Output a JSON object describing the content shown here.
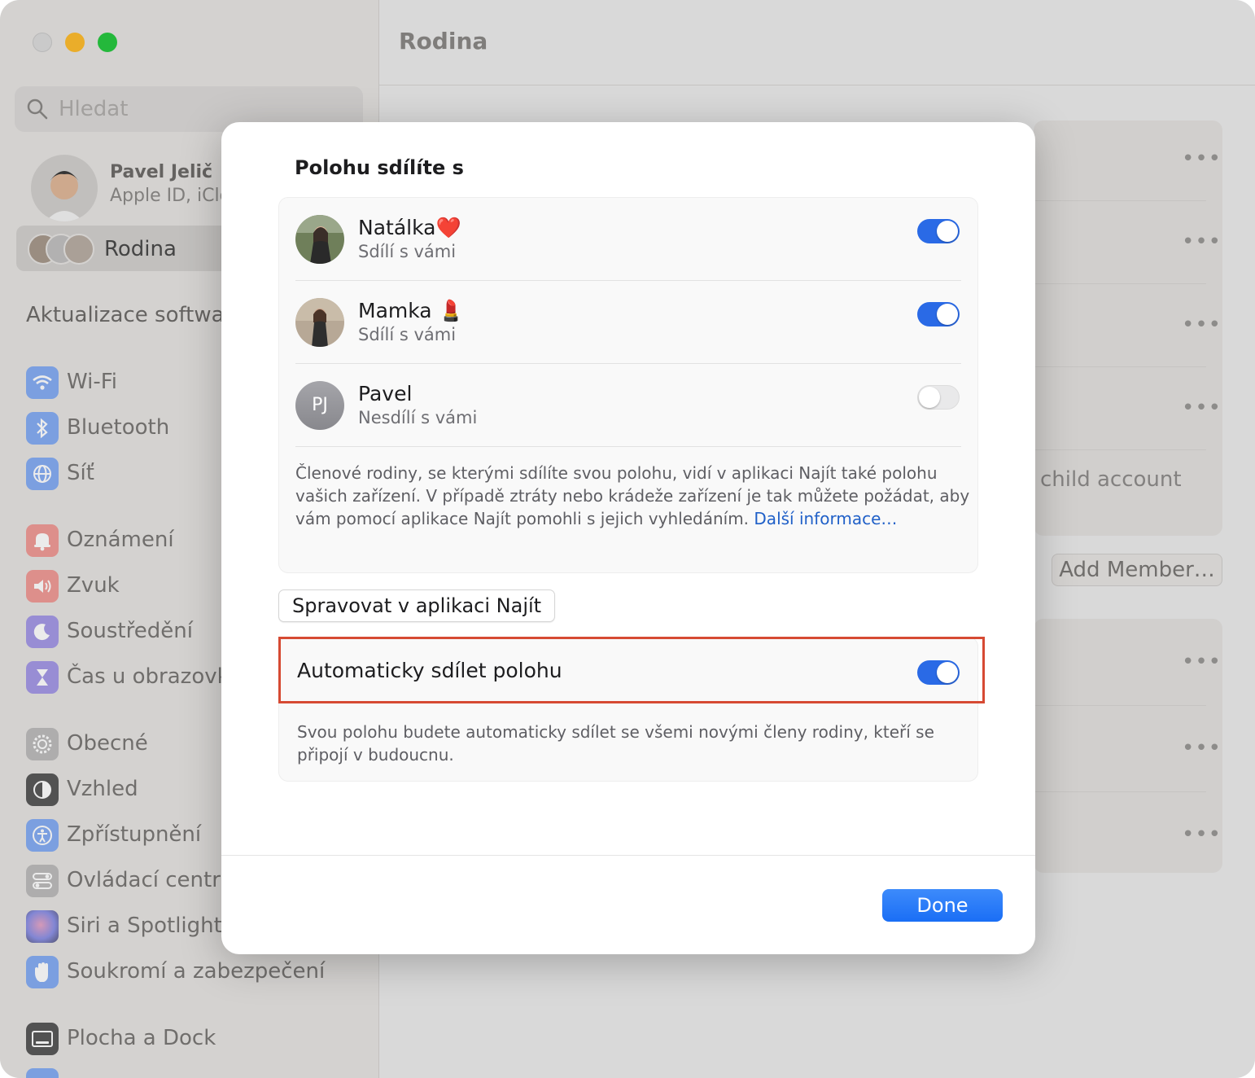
{
  "sidebar": {
    "search_placeholder": "Hledat",
    "profile": {
      "name": "Pavel Jelič",
      "subtitle": "Apple ID, iClo"
    },
    "selected_item": "Rodina",
    "update_label": "Aktualizace softwaru",
    "items": [
      {
        "label": "Wi‑Fi",
        "icon": "wifi-icon",
        "color": "#3a82f7"
      },
      {
        "label": "Bluetooth",
        "icon": "bluetooth-icon",
        "color": "#3a82f7"
      },
      {
        "label": "Síť",
        "icon": "globe-icon",
        "color": "#3a82f7"
      },
      {
        "label": "Oznámení",
        "icon": "bell-icon",
        "color": "#f05a54"
      },
      {
        "label": "Zvuk",
        "icon": "speaker-icon",
        "color": "#f05a54"
      },
      {
        "label": "Soustředění",
        "icon": "moon-icon",
        "color": "#6a5bd8"
      },
      {
        "label": "Čas u obrazovky",
        "icon": "hourglass-icon",
        "color": "#6a5bd8"
      },
      {
        "label": "Obecné",
        "icon": "gear-icon",
        "color": "#9a9a9e"
      },
      {
        "label": "Vzhled",
        "icon": "appearance-icon",
        "color": "#2a2a2a"
      },
      {
        "label": "Zpřístupnění",
        "icon": "accessibility-icon",
        "color": "#3a82f7"
      },
      {
        "label": "Ovládací centrum",
        "icon": "control-center-icon",
        "color": "#9a9a9e"
      },
      {
        "label": "Siri a Spotlight",
        "icon": "siri-icon",
        "color": "#8a5ad8"
      },
      {
        "label": "Soukromí a zabezpečení",
        "icon": "hand-icon",
        "color": "#3a82f7"
      },
      {
        "label": "Plocha a Dock",
        "icon": "dock-icon",
        "color": "#2a2a2a"
      }
    ]
  },
  "main": {
    "title": "Rodina",
    "child_account_text": "child account",
    "add_member_label": "Add Member…"
  },
  "dialog": {
    "title": "Polohu sdílíte s",
    "members": [
      {
        "name": "Natálka❤️",
        "status": "Sdílí s vámi",
        "sharing": true
      },
      {
        "name": "Mamka 💄",
        "status": "Sdílí s vámi",
        "sharing": true
      },
      {
        "name": "Pavel",
        "status": "Nesdílí s vámi",
        "sharing": false,
        "initials": "PJ"
      }
    ],
    "info_text": "Členové rodiny, se kterými sdílíte svou polohu, vidí v aplikaci Najít také polohu vašich zařízení. V případě ztráty nebo krádeže zařízení je tak můžete požádat, aby vám pomocí aplikace Najít pomohli s jejich vyhledáním.",
    "info_link": "Další informace…",
    "manage_button": "Spravovat v aplikaci Najít",
    "auto_share_label": "Automaticky sdílet polohu",
    "auto_share_on": true,
    "auto_share_desc": "Svou polohu budete automaticky sdílet se všemi novými členy rodiny, kteří se připojí v budoucnu.",
    "done_button": "Done"
  },
  "colors": {
    "accent": "#2a6ae6",
    "highlight_border": "#d64a33",
    "link": "#2060c8"
  }
}
